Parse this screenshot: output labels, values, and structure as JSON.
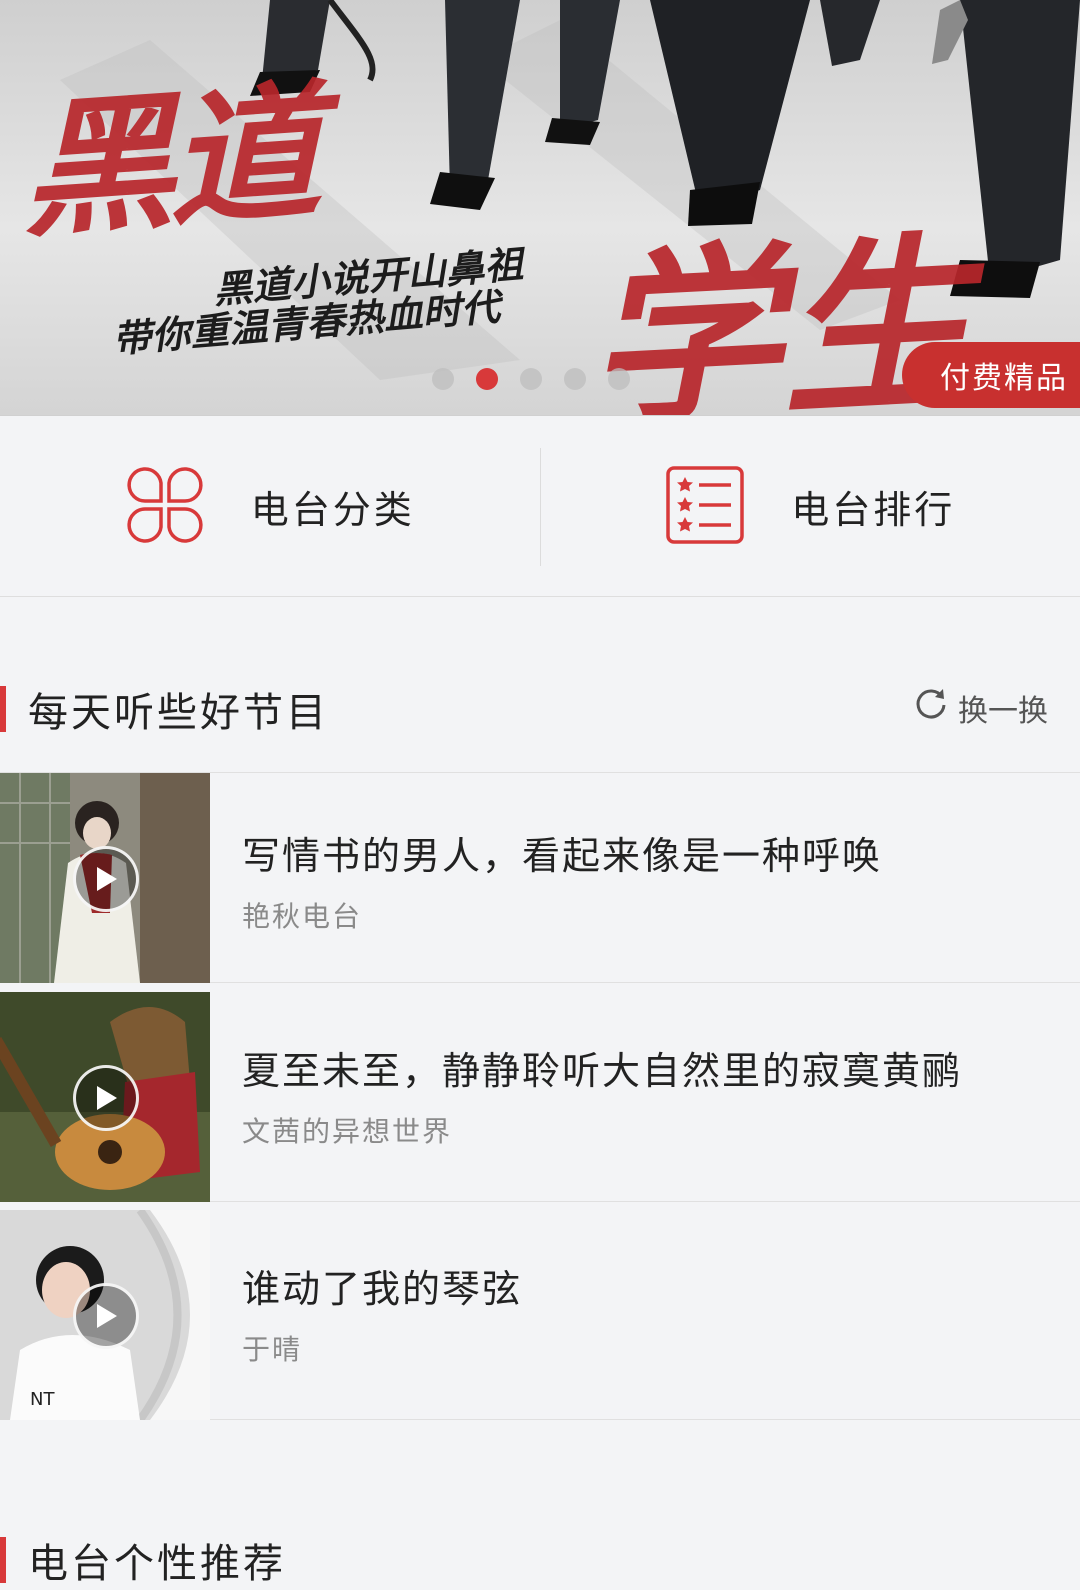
{
  "banner": {
    "title_a": "黑道",
    "title_b": "学生",
    "subtitle_1": "黑道小说开山鼻祖",
    "subtitle_2": "带你重温青春热血时代",
    "badge": "付费精品",
    "dots_count": 5,
    "active_dot": 2
  },
  "nav": {
    "category_label": "电台分类",
    "ranking_label": "电台排行"
  },
  "section": {
    "title": "每天听些好节目",
    "refresh_label": "换一换"
  },
  "programs": [
    {
      "title": "写情书的男人，看起来像是一种呼唤",
      "author": "艳秋电台"
    },
    {
      "title": "夏至未至，静静聆听大自然里的寂寞黄鹂",
      "author": "文茜的异想世界"
    },
    {
      "title": "谁动了我的琴弦",
      "author": "于晴"
    }
  ],
  "section2": {
    "title": "电台个性推荐"
  },
  "colors": {
    "accent": "#d8393a",
    "badge": "#c8302f"
  }
}
